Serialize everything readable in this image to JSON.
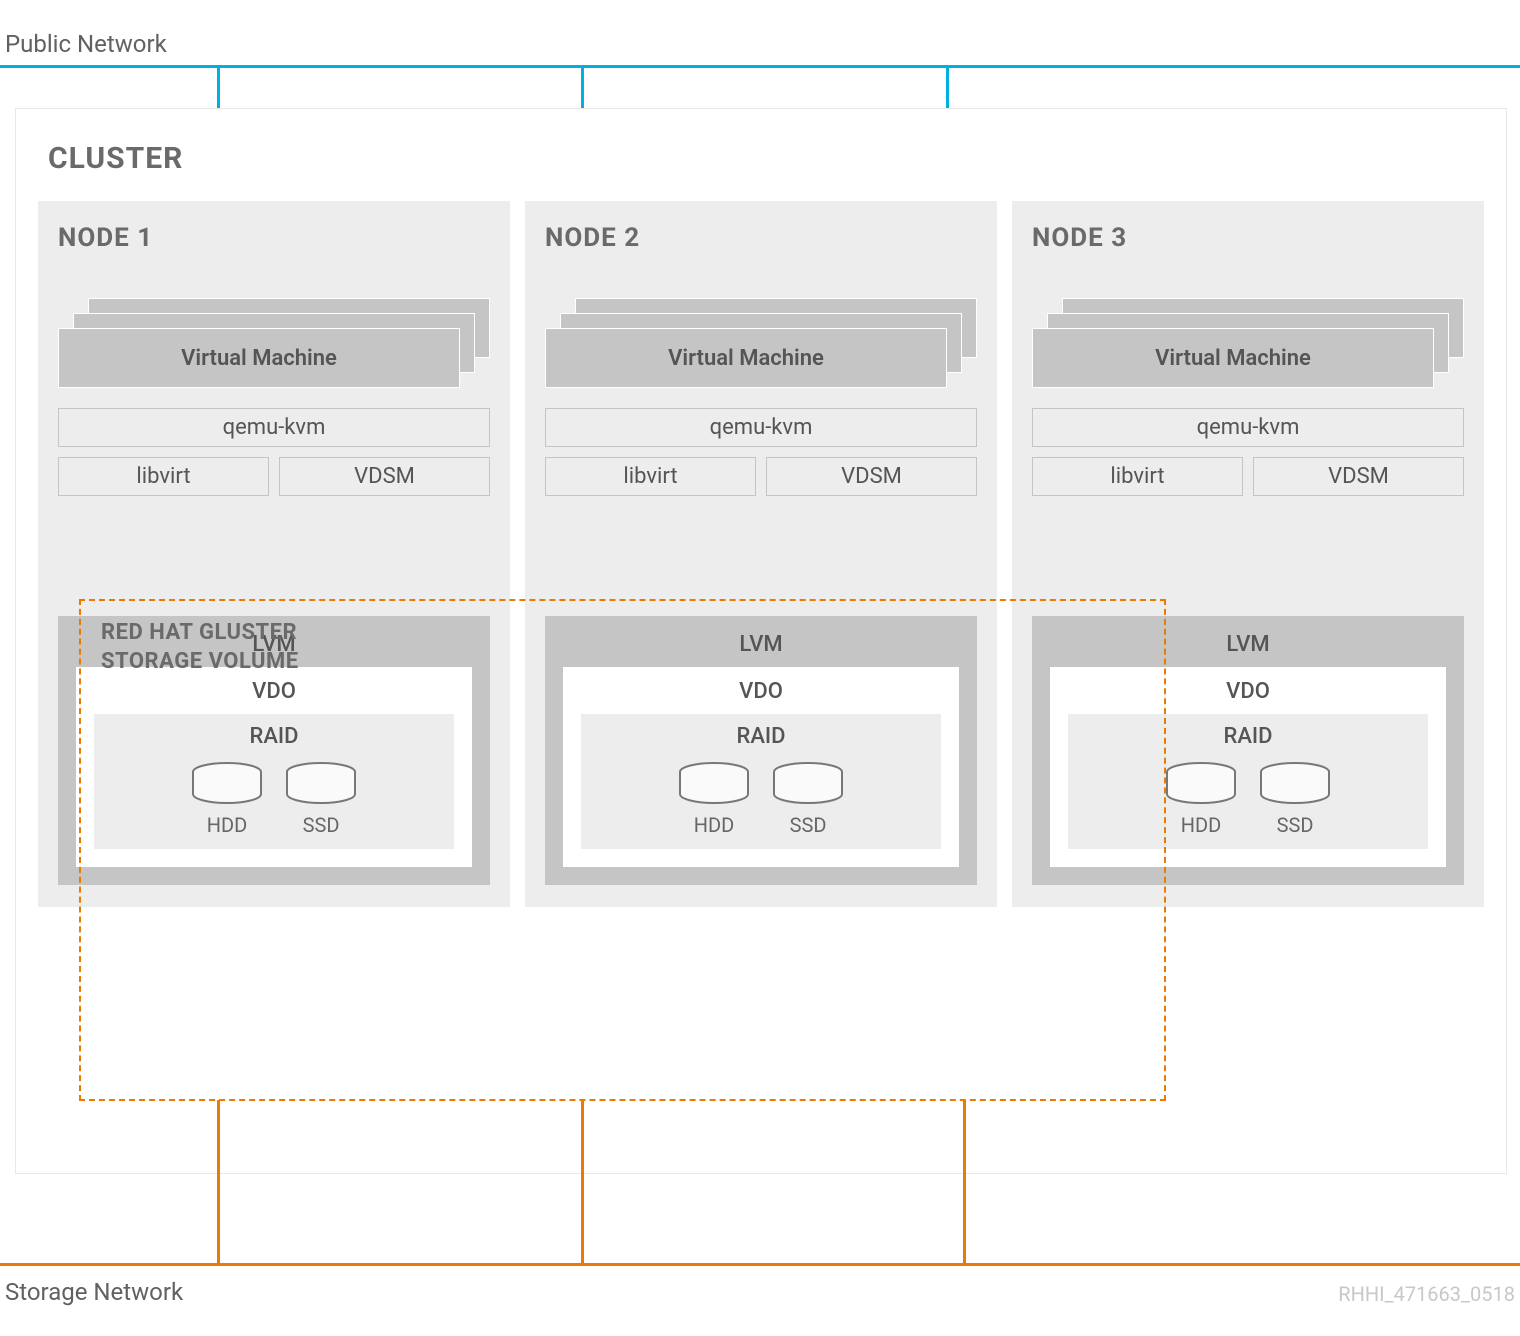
{
  "public_network_label": "Public Network",
  "storage_network_label": "Storage Network",
  "doc_id": "RHHI_471663_0518",
  "cluster": {
    "title": "CLUSTER",
    "gluster_title": "RED HAT GLUSTER\nSTORAGE VOLUME",
    "nodes": [
      {
        "title": "NODE 1",
        "vm_label": "Virtual Machine",
        "qemu": "qemu-kvm",
        "libvirt": "libvirt",
        "vdsm": "VDSM",
        "lvm": "LVM",
        "vdo": "VDO",
        "raid": "RAID",
        "hdd": "HDD",
        "ssd": "SSD"
      },
      {
        "title": "NODE 2",
        "vm_label": "Virtual Machine",
        "qemu": "qemu-kvm",
        "libvirt": "libvirt",
        "vdsm": "VDSM",
        "lvm": "LVM",
        "vdo": "VDO",
        "raid": "RAID",
        "hdd": "HDD",
        "ssd": "SSD"
      },
      {
        "title": "NODE 3",
        "vm_label": "Virtual Machine",
        "qemu": "qemu-kvm",
        "libvirt": "libvirt",
        "vdsm": "VDSM",
        "lvm": "LVM",
        "vdo": "VDO",
        "raid": "RAID",
        "hdd": "HDD",
        "ssd": "SSD"
      }
    ]
  }
}
